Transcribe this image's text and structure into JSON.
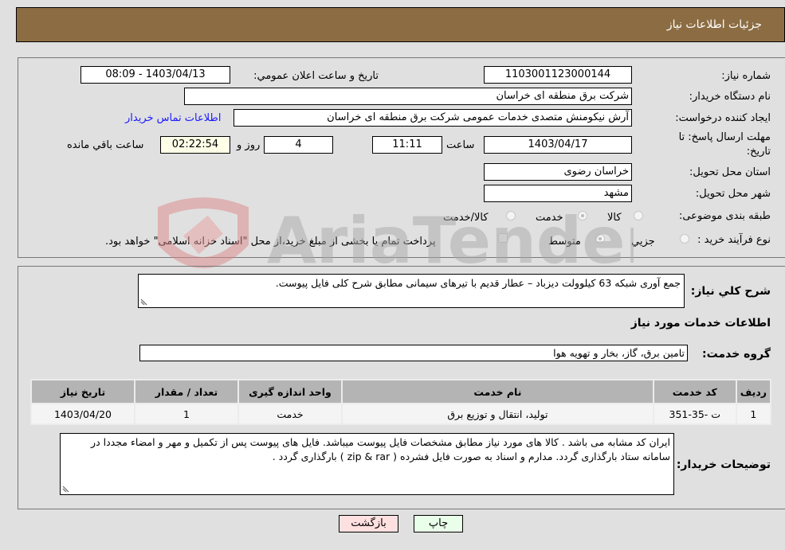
{
  "header": {
    "title": "جزئیات اطلاعات نیاز"
  },
  "form": {
    "need_number": {
      "label": "شماره نیاز:",
      "value": "1103001123000144"
    },
    "public_announce": {
      "label": "تاریخ و ساعت اعلان عمومي:",
      "value": "1403/04/13 - 08:09"
    },
    "buyer_org": {
      "label": "نام دستگاه خریدار:",
      "value": "شرکت برق منطقه ای خراسان"
    },
    "requester": {
      "label": "ایجاد کننده درخواست:",
      "value": "آرش نیکومنش متصدی خدمات عمومی شرکت برق منطقه ای خراسان"
    },
    "buyer_contact_link": "اطلاعات تماس خریدار",
    "deadline": {
      "label": "مهلت ارسال پاسخ: تا تاریخ:",
      "date": "1403/04/17",
      "time_label": "ساعت",
      "time": "11:11",
      "days": "4",
      "days_label": "روز و",
      "remaining": "02:22:54",
      "remaining_label": "ساعت باقي مانده"
    },
    "province": {
      "label": "استان محل تحویل:",
      "value": "خراسان رضوی"
    },
    "city": {
      "label": "شهر محل تحویل:",
      "value": "مشهد"
    },
    "category": {
      "label": "طبقه بندی موضوعی:",
      "options": [
        "کالا",
        "خدمت",
        "کالا/خدمت"
      ],
      "selected": "خدمت"
    },
    "purchase_type": {
      "label": "نوع فرآیند خرید :",
      "options": [
        "جزيي",
        "متوسط"
      ],
      "selected": "متوسط",
      "treasury_note": "پرداخت تمام یا بخشی از مبلغ خرید،از محل \"اسناد خزانه اسلامی\" خواهد بود."
    }
  },
  "details": {
    "description_label": "شرح کلي نياز:",
    "description": "جمع آوری شبکه 63 کیلوولت دیزباد – عطار قدیم با تیرهای سیمانی مطابق شرح کلی فایل پیوست.",
    "services_heading": "اطلاعات خدمات مورد نیاز",
    "service_group_label": "گروه خدمت:",
    "service_group": "تامین برق، گاز، بخار و تهویه هوا",
    "table": {
      "headers": [
        "ردیف",
        "کد خدمت",
        "نام خدمت",
        "واحد اندازه گیری",
        "تعداد / مقدار",
        "تاریخ نیاز"
      ],
      "rows": [
        [
          "1",
          "ت -35-351",
          "تولید، انتقال و توزیع برق",
          "خدمت",
          "1",
          "1403/04/20"
        ]
      ]
    },
    "buyer_notes_label": "توضیحات خریدار:",
    "buyer_notes": "ایران کد مشابه می باشد . کالا های مورد نیاز مطابق مشخصات فایل پیوست میباشد. فایل های پیوست پس از تکمیل و مهر و امضاء مجددا در سامانه ستاد بارگذاری گردد. مدارم و اسناد به صورت فایل فشرده ( zip & rar ) بارگذاری گردد ."
  },
  "buttons": {
    "print": "چاپ",
    "back": "بازگشت"
  },
  "colors": {
    "header_bg": "#8c6d43",
    "print_bg": "#eaffea",
    "back_bg": "#ffe0e0",
    "link": "#1a1aff"
  }
}
